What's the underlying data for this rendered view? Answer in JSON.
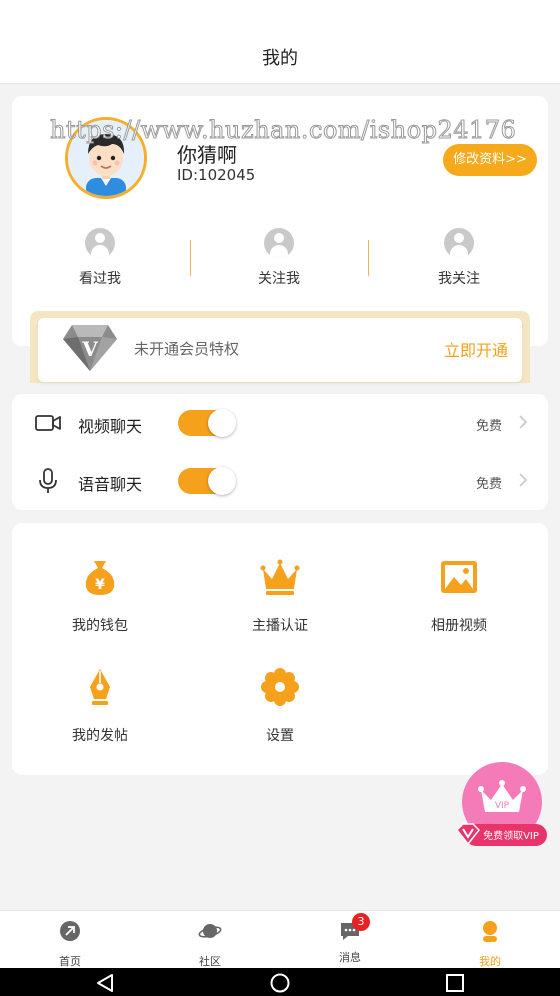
{
  "header": {
    "title": "我的"
  },
  "watermark": "https://www.huzhan.com/ishop24176",
  "profile": {
    "nickname": "你猜啊",
    "user_id": "ID:102045",
    "edit_label": "修改资料>>",
    "stats": [
      {
        "label": "看过我",
        "icon": "person-icon"
      },
      {
        "label": "关注我",
        "icon": "person-icon"
      },
      {
        "label": "我关注",
        "icon": "person-icon"
      }
    ]
  },
  "vip": {
    "badge_letter": "V",
    "text": "未开通会员特权",
    "action": "立即开通"
  },
  "chat": {
    "video": {
      "label": "视频聊天",
      "price": "免费",
      "enabled": true,
      "icon": "video-camera-icon"
    },
    "voice": {
      "label": "语音聊天",
      "price": "免费",
      "enabled": true,
      "icon": "microphone-icon"
    }
  },
  "features": [
    {
      "label": "我的钱包",
      "icon": "money-bag-icon"
    },
    {
      "label": "主播认证",
      "icon": "crown-icon"
    },
    {
      "label": "相册视频",
      "icon": "picture-icon"
    },
    {
      "label": "我的发帖",
      "icon": "pen-nib-icon"
    },
    {
      "label": "设置",
      "icon": "gear-icon"
    }
  ],
  "float_vip": {
    "crown_text": "VIP",
    "label": "免费领取VIP"
  },
  "tabbar": {
    "tabs": [
      {
        "label": "首页",
        "icon": "home-icon"
      },
      {
        "label": "社区",
        "icon": "planet-icon"
      },
      {
        "label": "消息",
        "icon": "message-icon",
        "badge": "3"
      },
      {
        "label": "我的",
        "icon": "user-icon"
      }
    ],
    "active_index": 3
  },
  "colors": {
    "accent": "#f5a11c",
    "background": "#f3f3f3",
    "badge": "#e82222"
  }
}
